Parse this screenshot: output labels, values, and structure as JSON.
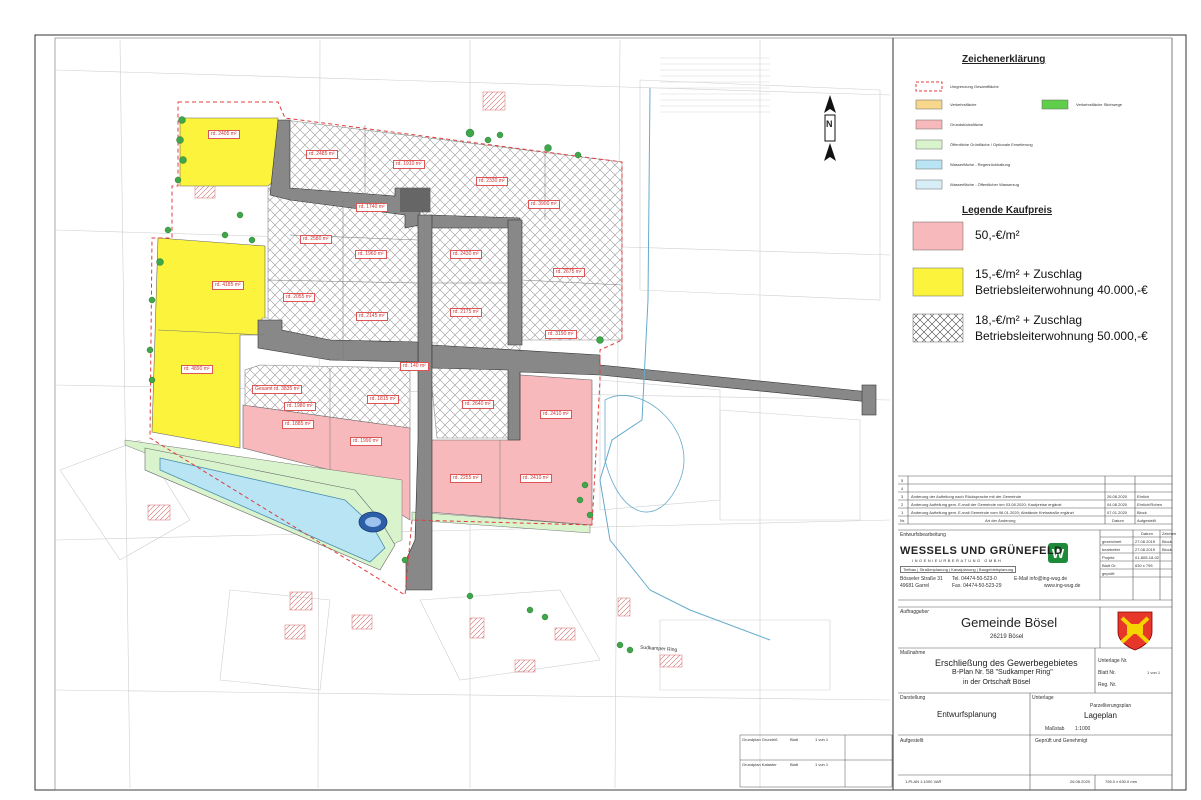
{
  "legend": {
    "title": "Zeichenerklärung",
    "items": [
      {
        "label": "Umgrenzung Gesamtfläche",
        "color": "#e23c3c",
        "style": "dashed"
      },
      {
        "label": "Verkehrsfläche",
        "color": "#f7d78c"
      },
      {
        "label": "Verkehrsfläche Stichwege",
        "color": "#5fcf4a"
      },
      {
        "label": "Grundstücksfläche",
        "color": "#f7b9bb"
      },
      {
        "label": "Öffentliche Grünfläche / Optionale Erweiterung",
        "color": "#d9f4cd"
      },
      {
        "label": "Wasserfläche - Regenrückhaltung",
        "color": "#b9e4f4"
      },
      {
        "label": "Wasserfläche - Öffentlicher Wasserzug",
        "color": "#d8eef7"
      }
    ],
    "price_title": "Legende Kaufpreis",
    "prices": [
      {
        "line1": "50,-€/m²",
        "line2": "",
        "color": "#f7b9bb",
        "pattern": "solid"
      },
      {
        "line1": "15,-€/m² + Zuschlag",
        "line2": "Betriebsleiterwohnung 40.000,-€",
        "color": "#fcf33d",
        "pattern": "solid"
      },
      {
        "line1": "18,-€/m² + Zuschlag",
        "line2": "Betriebsleiterwohnung 50.000,-€",
        "color": "#ffffff",
        "pattern": "crosshatch"
      }
    ]
  },
  "plots": [
    "rd. 2405 m²",
    "rd. 2485 m²",
    "rd. 1910 m²",
    "rd. 2330 m²",
    "rd. 1740 m²",
    "rd. 3900 m²",
    "rd. 2580 m²",
    "rd. 2430 m²",
    "rd. 1960 m²",
    "rd. 2675 m²",
    "rd. 4185 m²",
    "rd. 2055 m²",
    "rd. 2145 m²",
    "rd. 2175 m²",
    "rd. 3190 m²",
    "rd. 4890 m²",
    "Gesamt rd. 3835 m²",
    "rd. 1815 m²",
    "rd. 2640 m²",
    "rd. 2410 m²",
    "rd. 1980 m²",
    "rd. 1885 m²",
    "rd. 1990 m²",
    "rd. 2255 m²",
    "rd. 2410 m²",
    "rd. 140 m²"
  ],
  "map_labels": {
    "north": "N",
    "street": "Sudkamper Ring"
  },
  "revisions": {
    "rows": [
      {
        "nr": "5",
        "text": "",
        "date": "",
        "by": ""
      },
      {
        "nr": "4",
        "text": "",
        "date": "",
        "by": ""
      },
      {
        "nr": "3",
        "text": "Änderung der Aufteilung nach Rücksprache mit der Gemeinde",
        "date": "26.08.2020",
        "by": "Ehrlich"
      },
      {
        "nr": "2",
        "text": "Änderung Aufteilung gem. E-mail der Gemeinde vom 03.08.2020; Kaufpreise ergänzt",
        "date": "04.08.2020",
        "by": "Ehrlich/Rohen"
      },
      {
        "nr": "1",
        "text": "Änderung Aufteilung gem. E-mail Gemeinde vom 06.01.2020; Abstände Kreisstraße ergänzt",
        "date": "07.01.2020",
        "by": "Block"
      }
    ],
    "header": {
      "nr": "Nr.",
      "text": "Art der Änderung",
      "date": "Datum",
      "by": "Aufgestellt"
    }
  },
  "design": {
    "label": "Entwurfsbearbeitung",
    "company": "WESSELS UND GRÜNEFELD",
    "company_sub": "INGENIEURBERATUNG GMBH",
    "services": "Tiefbau | Straßenplanung | Kanalplanung | Baugebietsplanung",
    "address1": "Bösseler Straße 31",
    "address2": "49681 Garrel",
    "tel": "Tel. 04474-50-523-0",
    "fax": "Fax. 04474-50-523-29",
    "email": "E-Mail info@ing-wug.de",
    "web": "www.ing-wug.de",
    "info_header": {
      "c1": "",
      "c2": "Datum",
      "c3": "Zeichen"
    },
    "info_rows": [
      {
        "k": "gezeichnet",
        "v": "27.08.2019",
        "s": "Block"
      },
      {
        "k": "bearbeitet",
        "v": "27.08.2019",
        "s": "Block"
      },
      {
        "k": "Projekt",
        "v": "01-805-18-02",
        "s": ""
      },
      {
        "k": "Blatt Gr.",
        "v": "630 x 795",
        "s": ""
      },
      {
        "k": "geprüft",
        "v": "",
        "s": ""
      }
    ]
  },
  "client": {
    "label": "Auftraggeber",
    "name": "Gemeinde Bösel",
    "zip": "26219 Bösel"
  },
  "measure": {
    "label": "Maßnahme",
    "line1": "Erschließung des Gewerbegebietes",
    "line2": "B-Plan Nr. 58 \"Sudkamper Ring\"",
    "line3": "in der Ortschaft Bösel",
    "unterlage_nr": "Unterlage Nr.",
    "blatt_nr": "Blatt Nr.",
    "blatt_val": "1 von 1",
    "reg_nr": "Reg. Nr."
  },
  "presentation": {
    "label": "Darstellung",
    "value": "Entwurfsplanung",
    "unterlage_label": "Unterlage",
    "unterlage_sub": "Parzellierungsplan",
    "unterlage_value": "Lageplan",
    "scale_label": "Maßstab",
    "scale_value": "1:1000"
  },
  "signatures": {
    "aufgestellt": "Aufgestellt",
    "geprueft": "Geprüft und Genehmigt"
  },
  "footer": {
    "left": "1-PLAN 1:1000 VAR",
    "date": "26.08.2020",
    "size": "795.0 x 630.0 mm"
  },
  "stamp": {
    "row1": "Grundplan Grundriß",
    "row1b": "Blatt",
    "row1c": "1 von 1",
    "row2": "Grundplan Kataster",
    "row2b": "Blatt",
    "row2c": "1 von 1"
  }
}
